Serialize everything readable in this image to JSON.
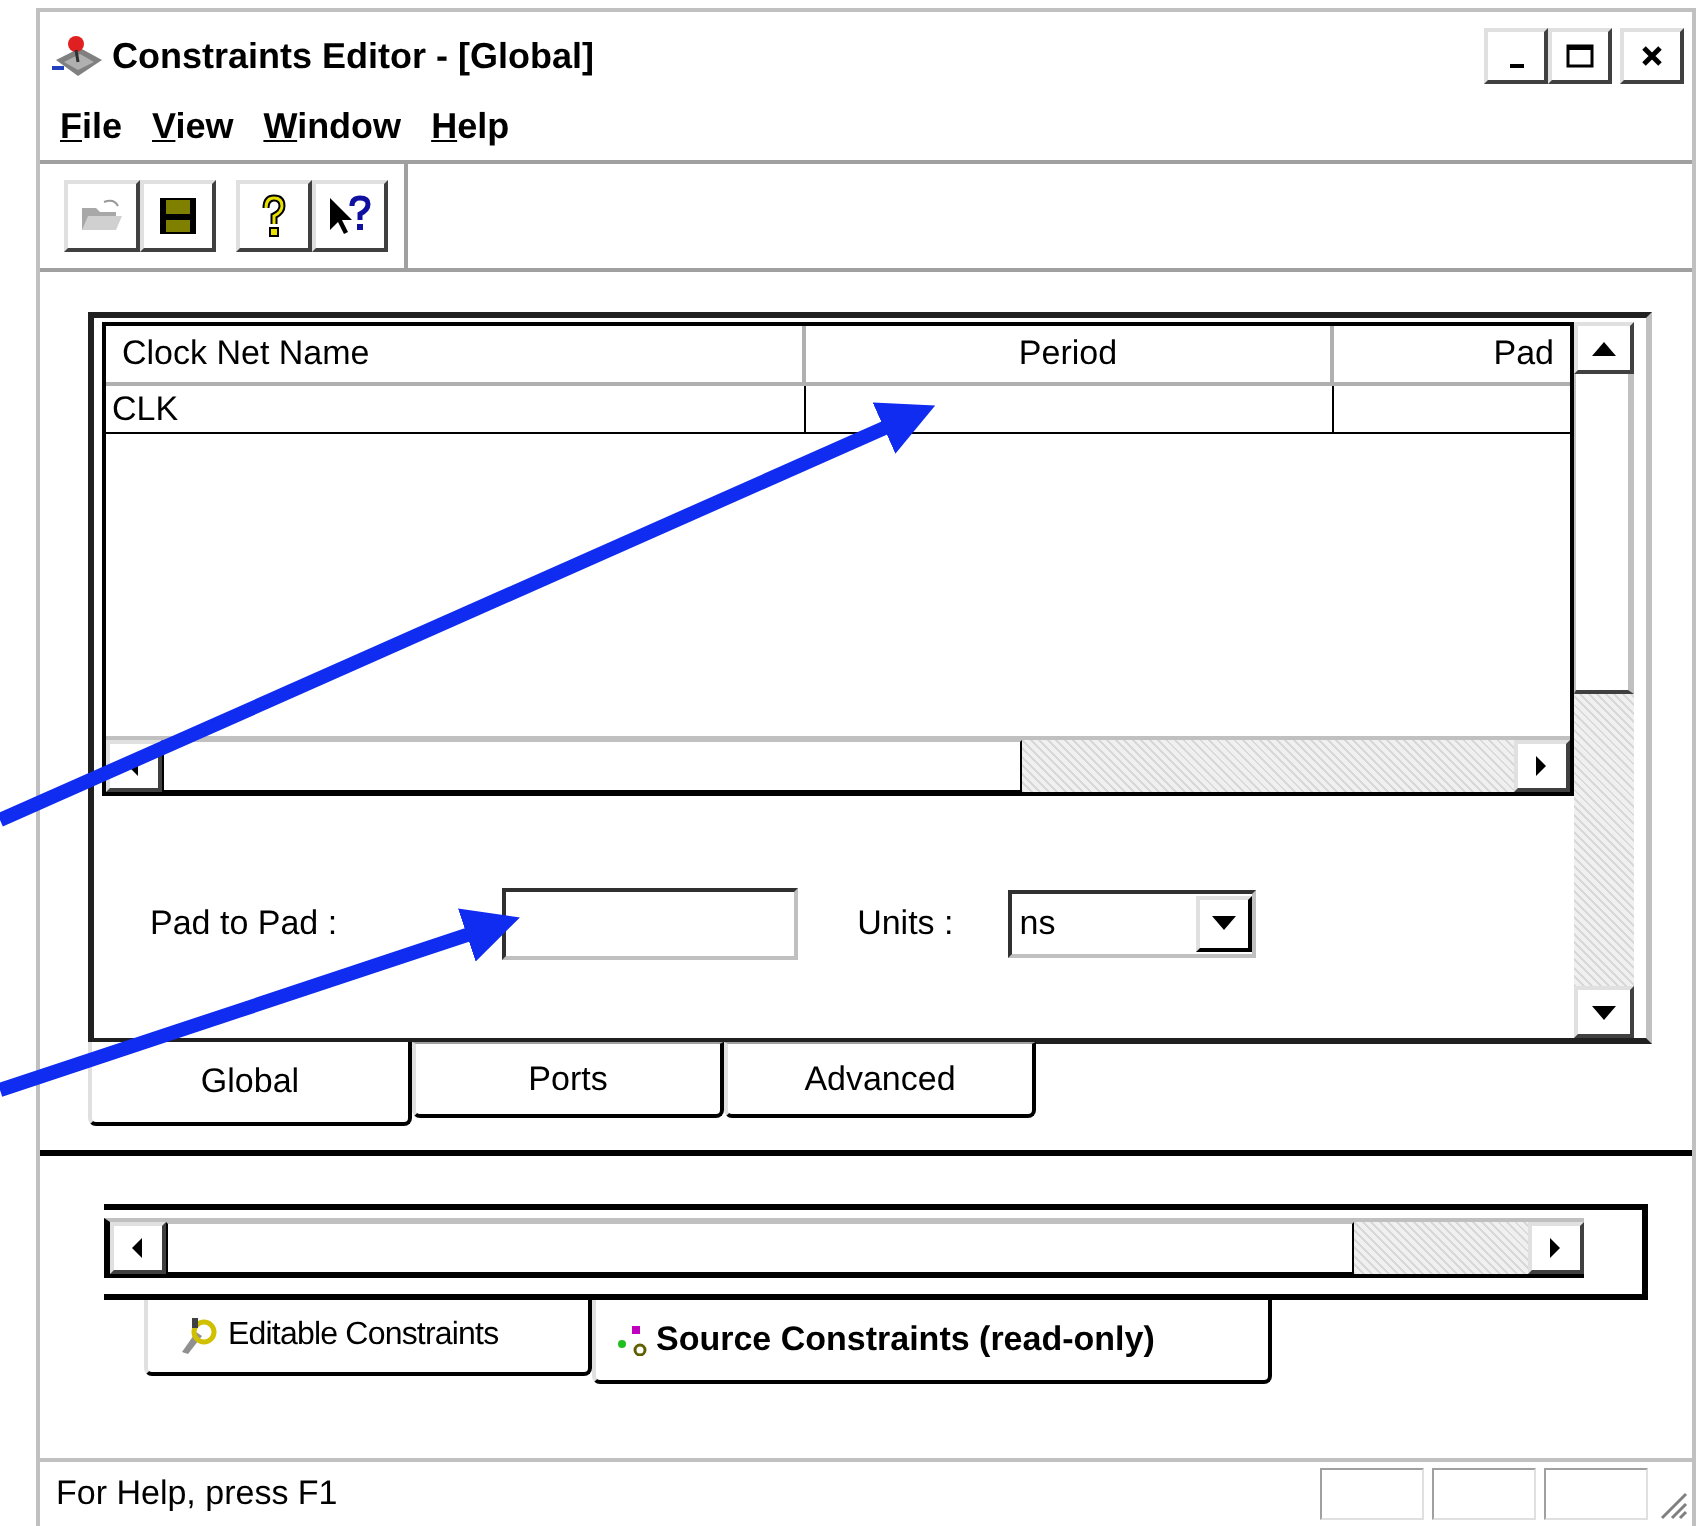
{
  "window": {
    "title": "Constraints Editor - [Global]"
  },
  "menu": [
    {
      "label": "File"
    },
    {
      "label": "View"
    },
    {
      "label": "Window"
    },
    {
      "label": "Help"
    }
  ],
  "table": {
    "columns": [
      "Clock Net Name",
      "Period",
      "Pad"
    ],
    "rows": [
      [
        "CLK"
      ]
    ]
  },
  "form": {
    "pad_to_pad": {
      "label": "Pad to Pad :"
    },
    "units": {
      "label": "Units :",
      "value": "ns"
    }
  },
  "tabs": [
    {
      "label": "Global",
      "selected": true
    },
    {
      "label": "Ports",
      "selected": false
    },
    {
      "label": "Advanced",
      "selected": false
    }
  ],
  "bottom_tabs": [
    {
      "label": "Editable Constraints",
      "selected": false
    },
    {
      "label": "Source Constraints (read-only)",
      "selected": true
    }
  ],
  "status_bar": {
    "text": "For Help, press F1"
  }
}
